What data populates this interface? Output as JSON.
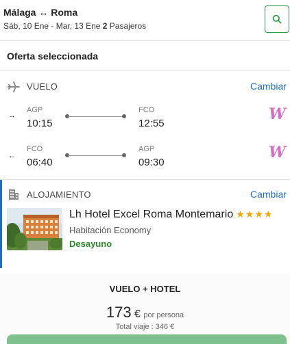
{
  "header": {
    "origin": "Málaga",
    "destination": "Roma",
    "dates": "Sáb, 10 Ene - Mar, 13 Ene",
    "passengers_count": "2",
    "passengers_label": "Pasajeros"
  },
  "offer_title": "Oferta seleccionada",
  "flight": {
    "section_label": "VUELO",
    "change_label": "Cambiar",
    "outbound": {
      "from_code": "AGP",
      "from_time": "10:15",
      "to_code": "FCO",
      "to_time": "12:55"
    },
    "inbound": {
      "from_code": "FCO",
      "from_time": "06:40",
      "to_code": "AGP",
      "to_time": "09:30"
    },
    "airline_glyph": "W"
  },
  "hotel": {
    "section_label": "ALOJAMIENTO",
    "change_label": "Cambiar",
    "name": "Lh Hotel Excel Roma Montemario",
    "stars": "★★★★",
    "room": "Habitación Economy",
    "board": "Desayuno"
  },
  "summary": {
    "package_label": "VUELO + HOTEL",
    "price": "173",
    "currency": "€",
    "per_person": "por persona",
    "total": "Total viaje : 346 €"
  },
  "colors": {
    "accent": "#1f6fc4",
    "green": "#2e9c48",
    "airline": "#d66cc6"
  },
  "icons": [
    "search-icon",
    "plane-icon",
    "arrow-right-icon",
    "arrow-left-icon",
    "building-icon",
    "swap-arrows-icon"
  ]
}
